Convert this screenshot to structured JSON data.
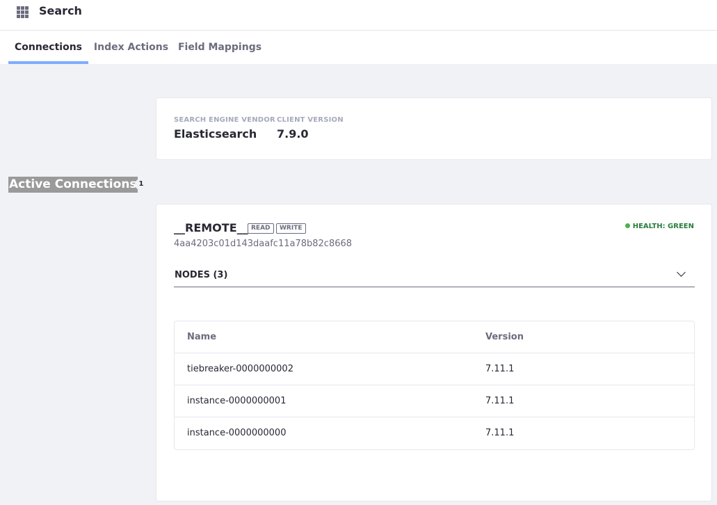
{
  "header": {
    "title": "Search",
    "apps_icon": "apps-grid-icon"
  },
  "tabs": [
    {
      "label": "Connections",
      "active": true
    },
    {
      "label": "Index Actions",
      "active": false
    },
    {
      "label": "Field Mappings",
      "active": false
    }
  ],
  "engine": {
    "vendor_label": "SEARCH ENGINE VENDOR",
    "vendor_value": "Elasticsearch",
    "client_label": "CLIENT VERSION",
    "client_value": "7.9.0"
  },
  "active_connections": {
    "title": "Active Connections",
    "count": "1"
  },
  "connection": {
    "name": "__REMOTE__",
    "badges": [
      "READ",
      "WRITE"
    ],
    "id": "4aa4203c01d143daafc11a78b82c8668",
    "health": "HEALTH: GREEN",
    "health_color": "#287d3c",
    "nodes_title": "NODES (3)",
    "columns": [
      "Name",
      "Version"
    ],
    "nodes": [
      {
        "name": "tiebreaker-0000000002",
        "version": "7.11.1"
      },
      {
        "name": "instance-0000000001",
        "version": "7.11.1"
      },
      {
        "name": "instance-0000000000",
        "version": "7.11.1"
      }
    ]
  },
  "colors": {
    "accent": "#80acff",
    "background": "#f1f2f5"
  }
}
